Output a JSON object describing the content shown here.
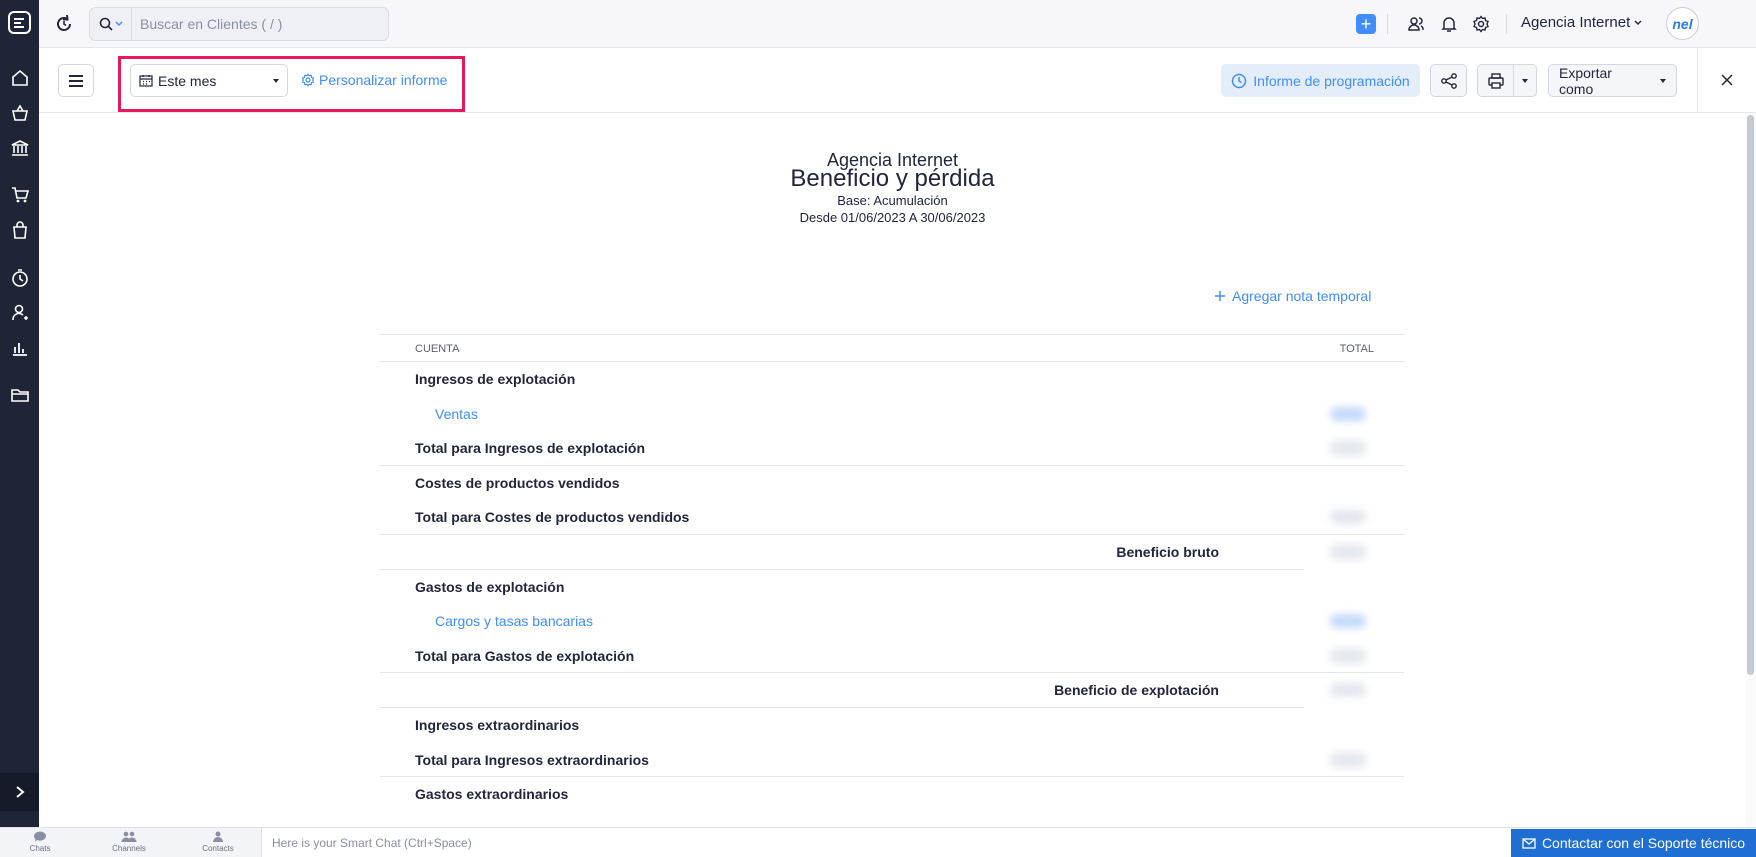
{
  "search": {
    "placeholder": "Buscar en Clientes ( / )"
  },
  "topbar": {
    "org_name": "Agencia Internet",
    "avatar_text": "nel"
  },
  "toolbar": {
    "period_value": "Este mes",
    "customize_label": "Personalizar informe",
    "schedule_label": "Informe de programación",
    "export_label": "Exportar como"
  },
  "report": {
    "org": "Agencia Internet",
    "title": "Beneficio y pérdida",
    "basis": "Base: Acumulación",
    "range": "Desde 01/06/2023 A 30/06/2023",
    "add_note": "Agregar nota temporal",
    "col_account": "CUENTA",
    "col_total": "TOTAL",
    "rows": [
      {
        "type": "group",
        "label": "Ingresos de explotación"
      },
      {
        "type": "acct",
        "label": "Ventas"
      },
      {
        "type": "total",
        "label": "Total para Ingresos de explotación"
      },
      {
        "type": "group",
        "label": "Costes de productos vendidos"
      },
      {
        "type": "total",
        "label": "Total para Costes de productos vendidos"
      },
      {
        "type": "summary",
        "label": "Beneficio bruto"
      },
      {
        "type": "group",
        "label": "Gastos de explotación"
      },
      {
        "type": "acct",
        "label": "Cargos y tasas bancarias"
      },
      {
        "type": "total",
        "label": "Total para Gastos de explotación"
      },
      {
        "type": "summary",
        "label": "Beneficio de explotación"
      },
      {
        "type": "group",
        "label": "Ingresos extraordinarios"
      },
      {
        "type": "total",
        "label": "Total para Ingresos extraordinarios"
      },
      {
        "type": "group",
        "label": "Gastos extraordinarios"
      }
    ]
  },
  "bottom": {
    "chats": "Chats",
    "channels": "Channels",
    "contacts": "Contacts",
    "smartchat_placeholder": "Here is your Smart Chat (Ctrl+Space)",
    "support": "Contactar con el Soporte técnico"
  },
  "colors": {
    "accent": "#408dfb",
    "rail": "#1f2436",
    "highlight": "#e8185c",
    "support": "#1e6ed4"
  }
}
